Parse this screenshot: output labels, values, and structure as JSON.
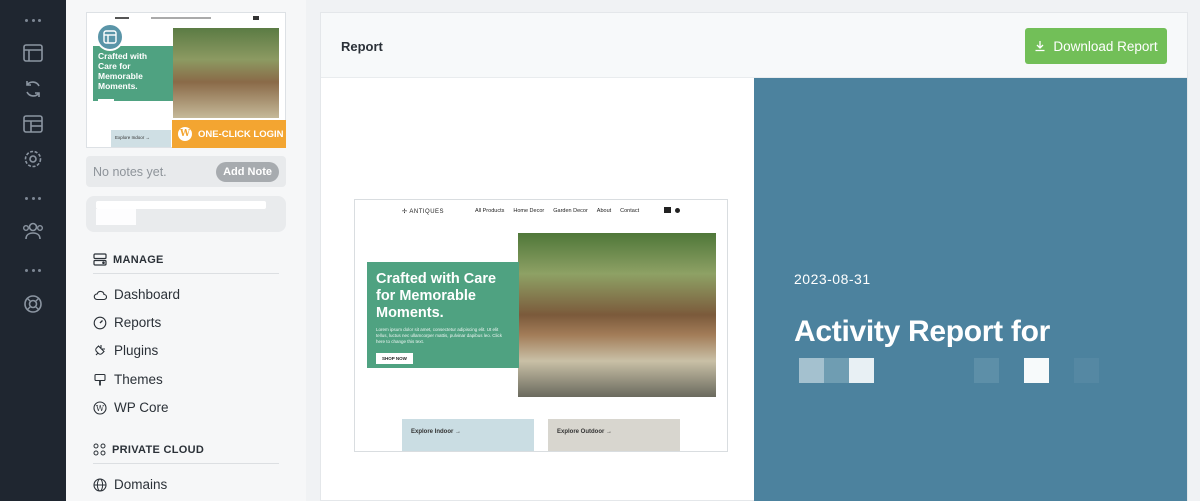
{
  "rail": {
    "icons": [
      "more-dots",
      "layout-icon",
      "sync-icon",
      "dashboard-layout-icon",
      "settings-icon",
      "more-dots",
      "users-icon",
      "more-dots",
      "support-icon"
    ]
  },
  "sidebar": {
    "thumbnail": {
      "headline": "Crafted with Care for Memorable Moments.",
      "explore": "Explore Indoor →",
      "login_label": "ONE-CLICK LOGIN"
    },
    "notes": {
      "placeholder": "No notes yet.",
      "add_button": "Add Note"
    },
    "manage": {
      "heading": "MANAGE",
      "items": [
        {
          "label": "Dashboard",
          "icon": "cloud-icon"
        },
        {
          "label": "Reports",
          "icon": "gauge-icon"
        },
        {
          "label": "Plugins",
          "icon": "plug-icon"
        },
        {
          "label": "Themes",
          "icon": "brush-icon"
        },
        {
          "label": "WP Core",
          "icon": "wordpress-icon"
        }
      ]
    },
    "private_cloud": {
      "heading": "PRIVATE CLOUD",
      "items": [
        {
          "label": "Domains",
          "icon": "globe-icon"
        }
      ]
    }
  },
  "main": {
    "title": "Report",
    "download_button": "Download Report",
    "preview": {
      "logo": "✢ ANTIQUES",
      "nav": [
        "All Products",
        "Home Decor",
        "Garden Decor",
        "About",
        "Contact"
      ],
      "headline": "Crafted with Care for Memorable Moments.",
      "body": "Lorem ipsum dolor sit amet, consectetur adipiscing elit. Ut elit tellus, luctus nec ullamcorper mattis, pulvinar dapibus leo. Click here to change this text.",
      "shop_button": "SHOP NOW",
      "explore_indoor": "Explore Indoor →",
      "explore_outdoor": "Explore Outdoor →"
    },
    "cover": {
      "date": "2023-08-31",
      "heading": "Activity Report for"
    }
  },
  "colors": {
    "rail": "#1f2630",
    "accent_green": "#72bf58",
    "brand_green": "#4fa281",
    "cover_blue": "#4c829e",
    "login_orange": "#f3a531"
  }
}
